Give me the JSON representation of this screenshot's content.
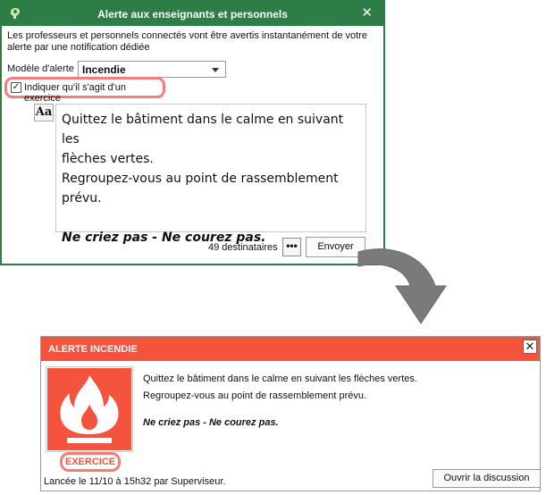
{
  "alert_dialog": {
    "title": "Alerte aux enseignants et personnels",
    "close_glyph": "✕",
    "intro": "Les professeurs et personnels connectés vont être avertis instantanément de votre alerte par une notification dédiée",
    "model_label": "Modèle d'alerte",
    "model_value": "Incendie",
    "exercise_label": "Indiquer qu'il s'agit d'un exercice",
    "exercise_checked": true,
    "check_glyph": "✓",
    "format_button": "Aa",
    "message_lines": [
      "Quittez le bâtiment dans le calme en suivant les",
      "flèches vertes.",
      "Regroupez-vous au point de rassemblement",
      "prévu."
    ],
    "message_emphasis": "Ne criez pas - Ne courez pas.",
    "recipients": "49 destinataires",
    "more_button": "•••",
    "send_button": "Envoyer",
    "theme_color": "#2e7d46"
  },
  "notification": {
    "title": "ALERTE INCENDIE",
    "close_glyph": "✕",
    "message_line1": "Quittez le bâtiment dans le calme en suivant les flèches vertes.",
    "message_line2": "Regroupez-vous au point de rassemblement prévu.",
    "message_emphasis": "Ne criez pas - Ne courez pas.",
    "exercise_badge": "EXERCICE",
    "launched_info": "Lancée le 11/10 à 15h32 par Superviseur.",
    "open_discussion_button": "Ouvrir la discussion",
    "icon": "fire-icon",
    "theme_color": "#f4533d"
  }
}
